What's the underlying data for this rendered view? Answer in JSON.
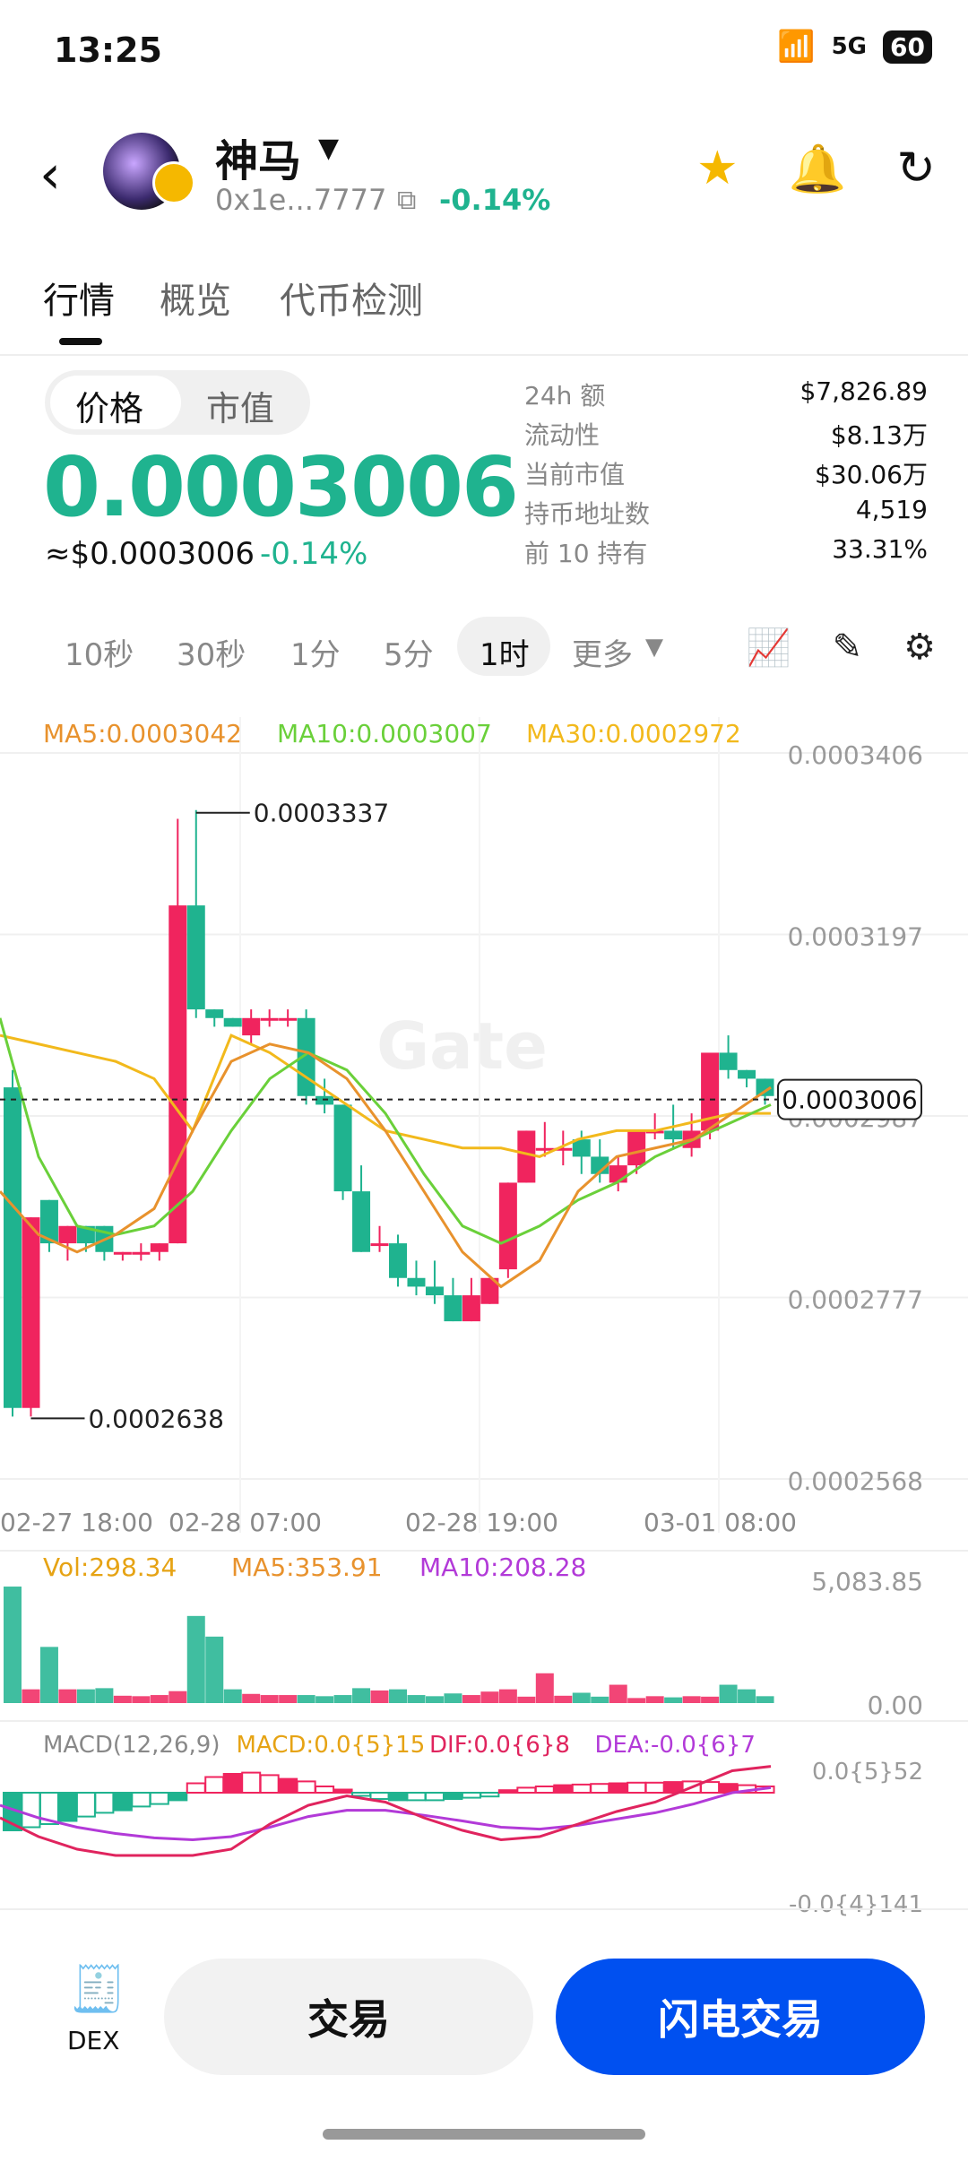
{
  "status": {
    "time": "13:25",
    "signal": "5G",
    "battery": "60"
  },
  "token": {
    "name": "神马",
    "address": "0x1e...7777",
    "change": "-0.14%"
  },
  "tabs": [
    "行情",
    "概览",
    "代币检测"
  ],
  "toggle": [
    "价格",
    "市值"
  ],
  "price": {
    "main": "0.0003006",
    "usd": "≈$0.0003006",
    "change": "-0.14%"
  },
  "stats": [
    {
      "label": "24h  额",
      "value": "$7,826.89"
    },
    {
      "label": "流动性",
      "value": "$8.13万"
    },
    {
      "label": "当前市值",
      "value": "$30.06万"
    },
    {
      "label": "持币地址数",
      "value": "4,519"
    },
    {
      "label": "前 10 持有",
      "value": "33.31%"
    }
  ],
  "intervals": [
    "10秒",
    "30秒",
    "1分",
    "5分",
    "1时",
    "更多"
  ],
  "chart_data": {
    "type": "candlestick",
    "ma_labels": [
      {
        "text": "MA5:0.0003042",
        "color": "#e8922d"
      },
      {
        "text": "MA10:0.0003007",
        "color": "#6ad03a"
      },
      {
        "text": "MA30:0.0002972",
        "color": "#f2b91c"
      }
    ],
    "y_ticks": [
      "0.0003406",
      "0.0003197",
      "0.0002987",
      "0.0002777",
      "0.0002568"
    ],
    "ylim": [
      0.0002568,
      0.0003406
    ],
    "x_labels": [
      "02-27 18:00",
      "02-28 07:00",
      "02-28 19:00",
      "03-01 08:00"
    ],
    "high_label": "0.0003337",
    "low_label": "0.0002638",
    "current_label": "0.0003006",
    "candles": [
      {
        "o": 0.000302,
        "h": 0.000304,
        "c": 0.000265,
        "l": 0.000264
      },
      {
        "o": 0.000265,
        "h": 0.000287,
        "c": 0.000287,
        "l": 0.000264
      },
      {
        "o": 0.000289,
        "h": 0.000289,
        "c": 0.000284,
        "l": 0.000283
      },
      {
        "o": 0.000284,
        "h": 0.000286,
        "c": 0.000286,
        "l": 0.000282
      },
      {
        "o": 0.000286,
        "h": 0.000286,
        "c": 0.000284,
        "l": 0.000283
      },
      {
        "o": 0.000286,
        "h": 0.000286,
        "c": 0.000283,
        "l": 0.000282
      },
      {
        "o": 0.000283,
        "h": 0.000283,
        "c": 0.000283,
        "l": 0.000282
      },
      {
        "o": 0.000283,
        "h": 0.000284,
        "c": 0.000283,
        "l": 0.000282
      },
      {
        "o": 0.000283,
        "h": 0.000284,
        "c": 0.000284,
        "l": 0.000282
      },
      {
        "o": 0.000284,
        "h": 0.000333,
        "c": 0.000323,
        "l": 0.000284
      },
      {
        "o": 0.000323,
        "h": 0.000334,
        "c": 0.000311,
        "l": 0.00031
      },
      {
        "o": 0.000311,
        "h": 0.000311,
        "c": 0.00031,
        "l": 0.000309
      },
      {
        "o": 0.00031,
        "h": 0.00031,
        "c": 0.000309,
        "l": 0.000309
      },
      {
        "o": 0.000308,
        "h": 0.000311,
        "c": 0.00031,
        "l": 0.000307
      },
      {
        "o": 0.00031,
        "h": 0.000311,
        "c": 0.00031,
        "l": 0.000309
      },
      {
        "o": 0.00031,
        "h": 0.000311,
        "c": 0.00031,
        "l": 0.000309
      },
      {
        "o": 0.00031,
        "h": 0.000311,
        "c": 0.000301,
        "l": 0.0003
      },
      {
        "o": 0.000301,
        "h": 0.000303,
        "c": 0.0003,
        "l": 0.000299
      },
      {
        "o": 0.0003,
        "h": 0.0003,
        "c": 0.00029,
        "l": 0.000289
      },
      {
        "o": 0.00029,
        "h": 0.000293,
        "c": 0.000283,
        "l": 0.000283
      },
      {
        "o": 0.000284,
        "h": 0.000286,
        "c": 0.000284,
        "l": 0.000283
      },
      {
        "o": 0.000284,
        "h": 0.000285,
        "c": 0.00028,
        "l": 0.000279
      },
      {
        "o": 0.00028,
        "h": 0.000282,
        "c": 0.000279,
        "l": 0.000278
      },
      {
        "o": 0.000279,
        "h": 0.000282,
        "c": 0.000278,
        "l": 0.000277
      },
      {
        "o": 0.000278,
        "h": 0.00028,
        "c": 0.000275,
        "l": 0.000275
      },
      {
        "o": 0.000275,
        "h": 0.00028,
        "c": 0.000278,
        "l": 0.000275
      },
      {
        "o": 0.000277,
        "h": 0.00028,
        "c": 0.00028,
        "l": 0.000277
      },
      {
        "o": 0.000281,
        "h": 0.000291,
        "c": 0.000291,
        "l": 0.00028
      },
      {
        "o": 0.000291,
        "h": 0.000297,
        "c": 0.000297,
        "l": 0.000291
      },
      {
        "o": 0.000295,
        "h": 0.000298,
        "c": 0.000295,
        "l": 0.000294
      },
      {
        "o": 0.000295,
        "h": 0.000297,
        "c": 0.000295,
        "l": 0.000293
      },
      {
        "o": 0.000296,
        "h": 0.000297,
        "c": 0.000294,
        "l": 0.000292
      },
      {
        "o": 0.000294,
        "h": 0.000296,
        "c": 0.000292,
        "l": 0.000291
      },
      {
        "o": 0.000291,
        "h": 0.000294,
        "c": 0.000293,
        "l": 0.00029
      },
      {
        "o": 0.000293,
        "h": 0.000297,
        "c": 0.000297,
        "l": 0.000292
      },
      {
        "o": 0.000297,
        "h": 0.000299,
        "c": 0.000297,
        "l": 0.000296
      },
      {
        "o": 0.000297,
        "h": 0.0003,
        "c": 0.000296,
        "l": 0.000295
      },
      {
        "o": 0.000295,
        "h": 0.000299,
        "c": 0.000297,
        "l": 0.000294
      },
      {
        "o": 0.000297,
        "h": 0.000306,
        "c": 0.000306,
        "l": 0.000296
      },
      {
        "o": 0.000306,
        "h": 0.000308,
        "c": 0.000304,
        "l": 0.000303
      },
      {
        "o": 0.000304,
        "h": 0.000304,
        "c": 0.000303,
        "l": 0.000302
      },
      {
        "o": 0.000303,
        "h": 0.000303,
        "c": 0.000301,
        "l": 0.0003
      }
    ],
    "ma5": [
      0.00029,
      0.000285,
      0.000283,
      0.000285,
      0.000288,
      0.000297,
      0.000305,
      0.000307,
      0.000306,
      0.000303,
      0.000297,
      0.00029,
      0.000283,
      0.000279,
      0.000282,
      0.00029,
      0.000294,
      0.000295,
      0.000296,
      0.000299,
      0.000302
    ],
    "ma10": [
      0.00031,
      0.000294,
      0.000286,
      0.000285,
      0.000286,
      0.00029,
      0.000297,
      0.000303,
      0.000306,
      0.000304,
      0.000299,
      0.000292,
      0.000286,
      0.000284,
      0.000286,
      0.000289,
      0.000291,
      0.000294,
      0.000296,
      0.000298,
      0.0003
    ],
    "ma30": [
      0.000308,
      0.000307,
      0.000306,
      0.000305,
      0.000303,
      0.000297,
      0.000308,
      0.000306,
      0.000303,
      0.0003,
      0.000297,
      0.000296,
      0.000295,
      0.000295,
      0.000294,
      0.000296,
      0.000297,
      0.000297,
      0.000298,
      0.000299,
      0.000299
    ],
    "volume": {
      "labels": [
        {
          "text": "Vol:298.34",
          "color": "#e6a314"
        },
        {
          "text": "MA5:353.91",
          "color": "#e8922d"
        },
        {
          "text": "MA10:208.28",
          "color": "#b23ad8"
        }
      ],
      "ticks": [
        "5,083.85",
        "0.00"
      ],
      "ylim": [
        0,
        5083.85
      ],
      "values": [
        5083,
        600,
        2450,
        600,
        600,
        650,
        320,
        300,
        350,
        520,
        3800,
        2900,
        600,
        400,
        350,
        350,
        350,
        300,
        350,
        650,
        550,
        600,
        350,
        300,
        420,
        350,
        500,
        600,
        280,
        1300,
        320,
        450,
        280,
        800,
        220,
        300,
        250,
        300,
        280,
        800,
        600,
        300
      ]
    },
    "macd": {
      "labels": [
        {
          "text": "MACD(12,26,9)",
          "color": "#888888"
        },
        {
          "text": "MACD:0.0{5}15",
          "color": "#e6a314"
        },
        {
          "text": "DIF:0.0{6}8",
          "color": "#e0245e"
        },
        {
          "text": "DEA:-0.0{6}7",
          "color": "#b23ad8"
        }
      ],
      "ticks": [
        "0.0{5}52",
        "-0.0{4}141"
      ],
      "hist": [
        -0.6,
        -0.55,
        -0.5,
        -0.45,
        -0.38,
        -0.32,
        -0.28,
        -0.22,
        -0.18,
        -0.12,
        0.15,
        0.25,
        0.3,
        0.32,
        0.28,
        0.22,
        0.18,
        0.1,
        0.05,
        -0.05,
        -0.1,
        -0.12,
        -0.12,
        -0.12,
        -0.1,
        -0.08,
        -0.06,
        0.04,
        0.08,
        0.1,
        0.12,
        0.13,
        0.14,
        0.15,
        0.16,
        0.16,
        0.17,
        0.18,
        0.17,
        0.14,
        0.12,
        0.1
      ],
      "dif": [
        -0.4,
        -0.7,
        -0.9,
        -1.0,
        -1.0,
        -1.0,
        -0.9,
        -0.5,
        -0.2,
        -0.05,
        -0.15,
        -0.4,
        -0.6,
        -0.75,
        -0.7,
        -0.5,
        -0.3,
        -0.15,
        0.1,
        0.35,
        0.42
      ],
      "dea": [
        -0.2,
        -0.4,
        -0.55,
        -0.65,
        -0.72,
        -0.75,
        -0.7,
        -0.55,
        -0.38,
        -0.28,
        -0.28,
        -0.36,
        -0.45,
        -0.55,
        -0.58,
        -0.52,
        -0.42,
        -0.32,
        -0.18,
        0.0,
        0.08
      ]
    }
  },
  "actions": {
    "dex": "DEX",
    "trade": "交易",
    "flash": "闪电交易"
  }
}
